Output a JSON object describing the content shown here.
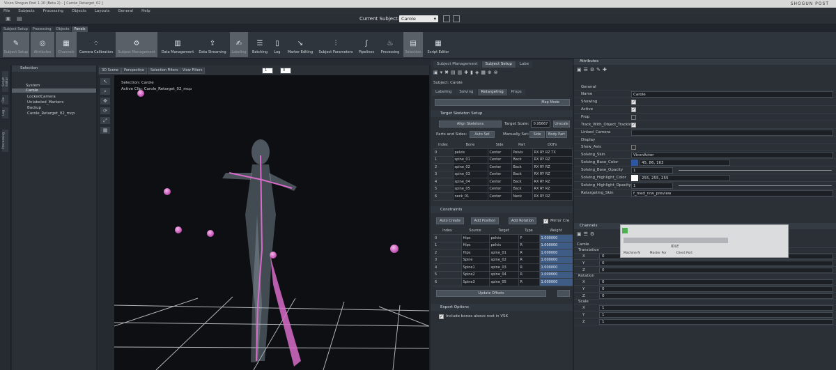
{
  "window": {
    "title": "Vicon Shogun Post 1.10 (Beta 2) - [ Carole_Retarget_02 ]",
    "brand": "SHOGUN POST"
  },
  "menu": [
    "File",
    "Subjects",
    "Processing",
    "Objects",
    "Layouts",
    "General",
    "Help"
  ],
  "subject": {
    "label": "Current Subject:",
    "value": "Carole"
  },
  "ribbon_tabs": [
    "Subject Setup",
    "Processing",
    "Objects",
    "Panels"
  ],
  "ribbon": [
    {
      "label": "Subject Setup",
      "icon": "wrench-icon"
    },
    {
      "label": "Attributes",
      "icon": "attributes-icon"
    },
    {
      "label": "Channels",
      "icon": "channels-icon"
    },
    {
      "label": "Camera Calibration",
      "icon": "camera-calibration-icon"
    },
    {
      "label": "Subject Management",
      "icon": "subject-management-icon"
    },
    {
      "label": "Data Management",
      "icon": "data-management-icon"
    },
    {
      "label": "Data Streaming",
      "icon": "data-streaming-icon"
    },
    {
      "label": "Labeling",
      "icon": "labeling-icon"
    },
    {
      "label": "Batching",
      "icon": "batching-icon"
    },
    {
      "label": "Log",
      "icon": "log-icon"
    },
    {
      "label": "Marker Editing",
      "icon": "marker-editing-icon"
    },
    {
      "label": "Subject Parameters",
      "icon": "subject-parameters-icon"
    },
    {
      "label": "Pipelines",
      "icon": "pipelines-icon"
    },
    {
      "label": "Processing",
      "icon": "processing-icon"
    },
    {
      "label": "Selection",
      "icon": "selection-icon"
    },
    {
      "label": "Script Editor",
      "icon": "script-editor-icon"
    }
  ],
  "left_tabs": [
    "Script Editor",
    "File",
    "Log",
    "Processing"
  ],
  "selection_panel": {
    "title": "Selection",
    "tree": [
      "System",
      "Carole",
      "LockedCamera",
      "Unlabeled_Markers",
      "Backup",
      "Carole_Retarget_02_mcp"
    ]
  },
  "viewport": {
    "scene": "3D Scene",
    "view": "Perspective",
    "filters": "Selection Filters",
    "view_filters": "View Filters",
    "field1": "1",
    "field2": "0",
    "selection_text": "Selection: Carole",
    "active_clip": "Active Clip: Carole_Retarget_02_mcp"
  },
  "subject_panel": {
    "tabs": [
      "Subject Management",
      "Subject Setup",
      "Labe"
    ],
    "subject_label": "Subject: Carole",
    "subtabs": [
      "Labeling",
      "Solving",
      "Retargeting",
      "Props"
    ],
    "map_mode": "Map Mode",
    "target_section": "Target Skeleton Setup",
    "align_skeletons": "Align Skeletons",
    "target_scale_label": "Target Scale:",
    "target_scale_value": "0.95667",
    "unscale": "Unscale",
    "parts_sides_label": "Parts and Sides:",
    "auto_set": "Auto Set",
    "manually_set": "Manually Set:",
    "side_sel": "Side",
    "body_part_sel": "Body Part",
    "bone_headers": [
      "Index",
      "Bone",
      "Side",
      "Part",
      "DOFs"
    ],
    "bones": [
      [
        "0",
        "pelvis",
        "Center",
        "Pelvis",
        "RX RY RZ TX"
      ],
      [
        "1",
        "spine_01",
        "Center",
        "Back",
        "RX RY RZ"
      ],
      [
        "2",
        "spine_02",
        "Center",
        "Back",
        "RX RY RZ"
      ],
      [
        "3",
        "spine_03",
        "Center",
        "Back",
        "RX RY RZ"
      ],
      [
        "4",
        "spine_04",
        "Center",
        "Back",
        "RX RY RZ"
      ],
      [
        "5",
        "spine_05",
        "Center",
        "Back",
        "RX RY RZ"
      ],
      [
        "6",
        "neck_01",
        "Center",
        "Neck",
        "RX RY RZ"
      ]
    ],
    "constraints_section": "Constraints",
    "auto_create": "Auto Create",
    "add_position": "Add Position",
    "add_rotation": "Add Rotation",
    "mirror": "Mirror Cre",
    "constraint_headers": [
      "Index",
      "Source",
      "Target",
      "Type",
      "Weight"
    ],
    "constraints": [
      [
        "0",
        "Hips",
        "pelvis",
        "P",
        "1.000000"
      ],
      [
        "1",
        "Hips",
        "pelvis",
        "R",
        "1.000000"
      ],
      [
        "2",
        "Hips",
        "spine_01",
        "R",
        "1.000000"
      ],
      [
        "3",
        "Spine",
        "spine_02",
        "R",
        "1.000000"
      ],
      [
        "4",
        "Spine1",
        "spine_03",
        "R",
        "1.000000"
      ],
      [
        "5",
        "Spine2",
        "spine_04",
        "R",
        "1.000000"
      ],
      [
        "6",
        "Spine3",
        "spine_05",
        "R",
        "1.000000"
      ]
    ],
    "update_offsets": "Update Offsets",
    "export_section": "Export Options",
    "include_bones": "Include bones above root in VSK"
  },
  "attributes": {
    "title": "Attributes",
    "section_general": "General",
    "name_label": "Name",
    "name_value": "Carole",
    "showing_label": "Showing",
    "active_label": "Active",
    "prop_label": "Prop",
    "track_label": "Track_With_Object_Tracking",
    "linked_camera_label": "Linked_Camera",
    "section_display": "Display",
    "show_axis_label": "Show_Axis",
    "solving_skin_label": "Solving_Skin",
    "solving_skin_value": "ViconActor",
    "base_color_label": "Solving_Base_Color",
    "base_color_value": "45, 86, 163",
    "base_color_hex": "#2d56a3",
    "base_opacity_label": "Solving_Base_Opacity",
    "base_opacity_value": "1",
    "highlight_color_label": "Solving_Highlight_Color",
    "highlight_color_value": "255, 255, 255",
    "highlight_color_hex": "#ffffff",
    "highlight_opacity_label": "Solving_Highlight_Opacity",
    "highlight_opacity_value": "1",
    "retarget_skin_label": "Retargeting_Skin",
    "retarget_skin_value": "f_med_nrw_preview"
  },
  "channels": {
    "title": "Channels",
    "subject": "Carole",
    "translation": "Translation",
    "rotation": "Rotation",
    "scale": "Scale",
    "t": [
      [
        "X",
        "0"
      ],
      [
        "Y",
        "0"
      ],
      [
        "Z",
        "0"
      ]
    ],
    "r": [
      [
        "X",
        "0"
      ],
      [
        "Y",
        "0"
      ],
      [
        "Z",
        "0"
      ]
    ],
    "s": [
      [
        "X",
        "1"
      ],
      [
        "Y",
        "1"
      ],
      [
        "Z",
        "1"
      ]
    ],
    "popup_status": "IDLE",
    "popup_fields": [
      "Machine N",
      "Master Por",
      "Client Port"
    ]
  },
  "colors": {
    "accent": "#3f5c86",
    "marker": "#e07ad0",
    "bone": "#d86cc8"
  }
}
